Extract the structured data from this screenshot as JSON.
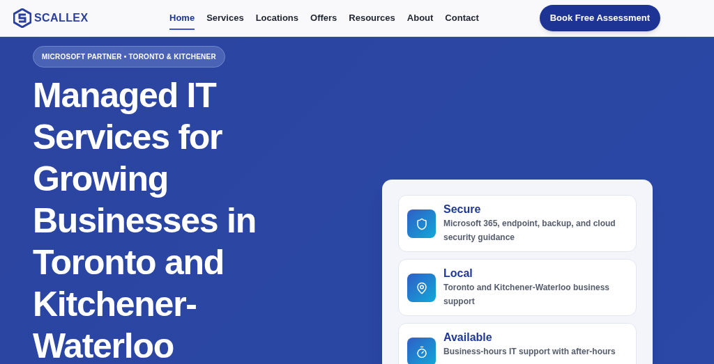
{
  "brand": {
    "name": "SCALLEX"
  },
  "nav": [
    {
      "label": "Home",
      "selected": true
    },
    {
      "label": "Services",
      "selected": false
    },
    {
      "label": "Locations",
      "selected": false
    },
    {
      "label": "Offers",
      "selected": false
    },
    {
      "label": "Resources",
      "selected": false
    },
    {
      "label": "About",
      "selected": false
    },
    {
      "label": "Contact",
      "selected": false
    }
  ],
  "cta": "Book Free Assessment",
  "hero": {
    "badge": "MICROSOFT PARTNER • TORONTO & KITCHENER",
    "heading": "Managed IT Services for Growing Businesses in Toronto and Kitchener-Waterloo"
  },
  "features": [
    {
      "kind": "shield",
      "title": "Secure",
      "text": "Microsoft 365, endpoint, backup, and cloud security guidance"
    },
    {
      "kind": "pin",
      "title": "Local",
      "text": "Toronto and Kitchener-Waterloo business support"
    },
    {
      "kind": "timer",
      "title": "Available",
      "text": "Business-hours IT support with after-hours"
    }
  ]
}
